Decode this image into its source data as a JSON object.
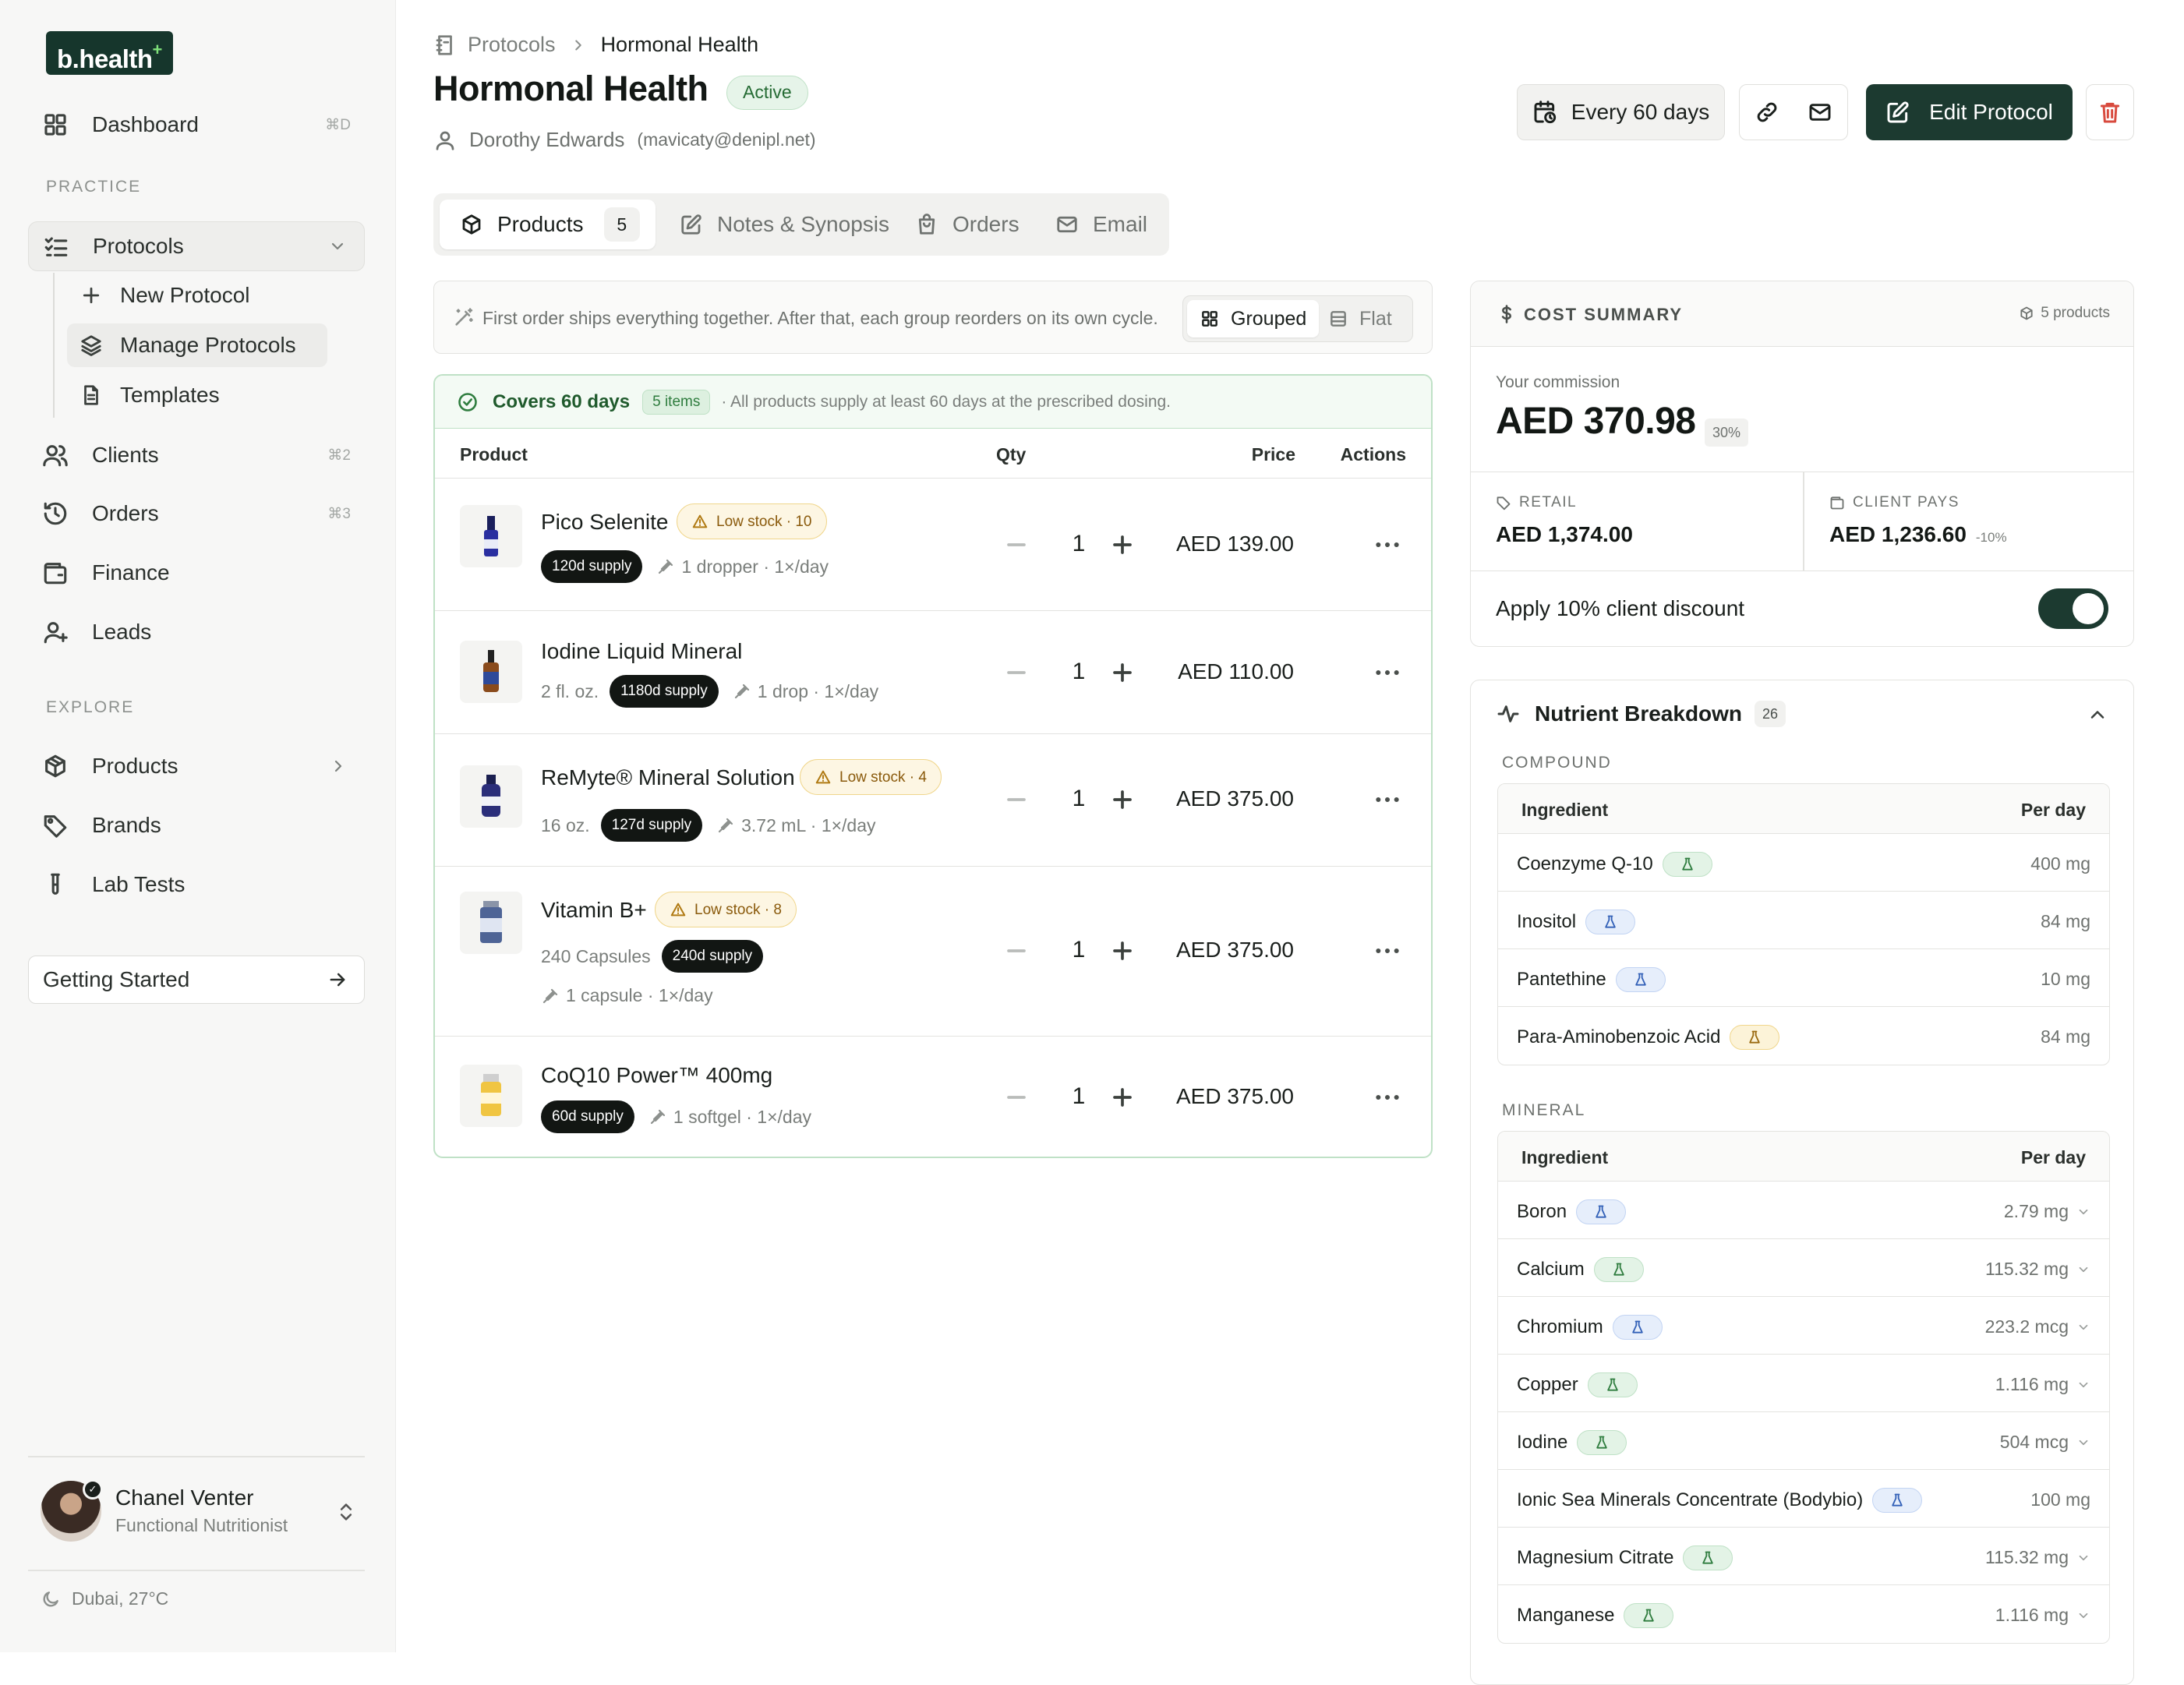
{
  "sidebar": {
    "logo": "b.health",
    "logo_mark": "+",
    "nav": [
      {
        "label": "Dashboard",
        "shortcut": "⌘D",
        "icon": "grid-icon"
      },
      {
        "label": "Protocols",
        "icon": "checklist-icon"
      },
      {
        "label": "Clients",
        "shortcut": "⌘2",
        "icon": "users-icon"
      },
      {
        "label": "Orders",
        "shortcut": "⌘3",
        "icon": "history-icon"
      },
      {
        "label": "Finance",
        "icon": "wallet-icon"
      },
      {
        "label": "Leads",
        "icon": "user-plus-icon"
      },
      {
        "label": "Products",
        "icon": "box-icon"
      },
      {
        "label": "Brands",
        "icon": "tag-icon"
      },
      {
        "label": "Lab Tests",
        "icon": "test-tube-icon"
      }
    ],
    "sections": {
      "practice": "PRACTICE",
      "explore": "EXPLORE"
    },
    "protocol_sub": [
      {
        "label": "New Protocol",
        "icon": "plus-icon"
      },
      {
        "label": "Manage Protocols",
        "icon": "layers-icon"
      },
      {
        "label": "Templates",
        "icon": "document-icon"
      }
    ],
    "getting_started": "Getting Started",
    "user": {
      "name": "Chanel Venter",
      "role": "Functional Nutritionist"
    },
    "weather": "Dubai, 27°C"
  },
  "header": {
    "breadcrumb": [
      "Protocols",
      "Hormonal Health"
    ],
    "title": "Hormonal Health",
    "status": "Active",
    "client_name": "Dorothy Edwards",
    "client_email": "(mavicaty@denipl.net)",
    "schedule": "Every 60 days",
    "edit_label": "Edit Protocol"
  },
  "tabs": [
    {
      "label": "Products",
      "count": "5",
      "icon": "box-icon"
    },
    {
      "label": "Notes & Synopsis",
      "icon": "edit-icon"
    },
    {
      "label": "Orders",
      "icon": "bag-icon"
    },
    {
      "label": "Email",
      "icon": "mail-icon"
    }
  ],
  "info": {
    "text": "First order ships everything together. After that, each group reorders on its own cycle.",
    "view_grouped": "Grouped",
    "view_flat": "Flat"
  },
  "products": {
    "covers_title": "Covers 60 days",
    "covers_count": "5 items",
    "covers_note": "· All products supply at least 60 days at the prescribed dosing.",
    "columns": [
      "Product",
      "Qty",
      "Price",
      "Actions"
    ],
    "rows": [
      {
        "name": "Pico Selenite",
        "low_stock": "Low stock · 10",
        "size": "",
        "supply": "120d supply",
        "dose": "1 dropper · 1×/day",
        "qty": "1",
        "price": "AED 139.00"
      },
      {
        "name": "Iodine Liquid Mineral",
        "low_stock": "",
        "size": "2 fl. oz.",
        "supply": "1180d supply",
        "dose": "1 drop · 1×/day",
        "qty": "1",
        "price": "AED 110.00"
      },
      {
        "name": "ReMyte® Mineral Solution",
        "low_stock": "Low stock · 4",
        "size": "16 oz.",
        "supply": "127d supply",
        "dose": "3.72 mL · 1×/day",
        "qty": "1",
        "price": "AED 375.00"
      },
      {
        "name": "Vitamin B+",
        "low_stock": "Low stock · 8",
        "size": "240 Capsules",
        "supply": "240d supply",
        "dose": "1 capsule · 1×/day",
        "qty": "1",
        "price": "AED 375.00"
      },
      {
        "name": "CoQ10 Power™ 400mg",
        "low_stock": "",
        "size": "",
        "supply": "60d supply",
        "dose": "1 softgel · 1×/day",
        "qty": "1",
        "price": "AED 375.00"
      }
    ]
  },
  "cost_summary": {
    "title": "COST SUMMARY",
    "count": "5 products",
    "commission_label": "Your commission",
    "commission": "AED 370.98",
    "commission_pct": "30%",
    "retail_label": "RETAIL",
    "retail": "AED 1,374.00",
    "client_label": "CLIENT PAYS",
    "client_pays": "AED 1,236.60",
    "client_discount": "-10%",
    "discount_toggle_label": "Apply 10% client discount",
    "discount_on": true
  },
  "nutrients": {
    "title": "Nutrient Breakdown",
    "count": "26",
    "col_ingredient": "Ingredient",
    "col_per_day": "Per day",
    "groups": [
      {
        "label": "COMPOUND",
        "rows": [
          {
            "name": "Coenzyme Q-10",
            "tag": "green",
            "value": "400 mg",
            "expand": false
          },
          {
            "name": "Inositol",
            "tag": "blue",
            "value": "84 mg",
            "expand": false
          },
          {
            "name": "Pantethine",
            "tag": "blue",
            "value": "10 mg",
            "expand": false
          },
          {
            "name": "Para-Aminobenzoic Acid",
            "tag": "yellow",
            "value": "84 mg",
            "expand": false
          }
        ]
      },
      {
        "label": "MINERAL",
        "rows": [
          {
            "name": "Boron",
            "tag": "blue",
            "value": "2.79 mg",
            "expand": true
          },
          {
            "name": "Calcium",
            "tag": "green",
            "value": "115.32 mg",
            "expand": true
          },
          {
            "name": "Chromium",
            "tag": "blue",
            "value": "223.2 mcg",
            "expand": true
          },
          {
            "name": "Copper",
            "tag": "green",
            "value": "1.116 mg",
            "expand": true
          },
          {
            "name": "Iodine",
            "tag": "green",
            "value": "504 mcg",
            "expand": true
          },
          {
            "name": "Ionic Sea Minerals Concentrate (Bodybio)",
            "tag": "blue",
            "value": "100 mg",
            "expand": false
          },
          {
            "name": "Magnesium Citrate",
            "tag": "green",
            "value": "115.32 mg",
            "expand": true
          },
          {
            "name": "Manganese",
            "tag": "green",
            "value": "1.116 mg",
            "expand": true
          }
        ]
      }
    ]
  },
  "colors": {
    "brand": "#1c3a30",
    "accent_green": "#7fe07a",
    "warning": "#b07a13",
    "danger": "#d84a3e"
  }
}
